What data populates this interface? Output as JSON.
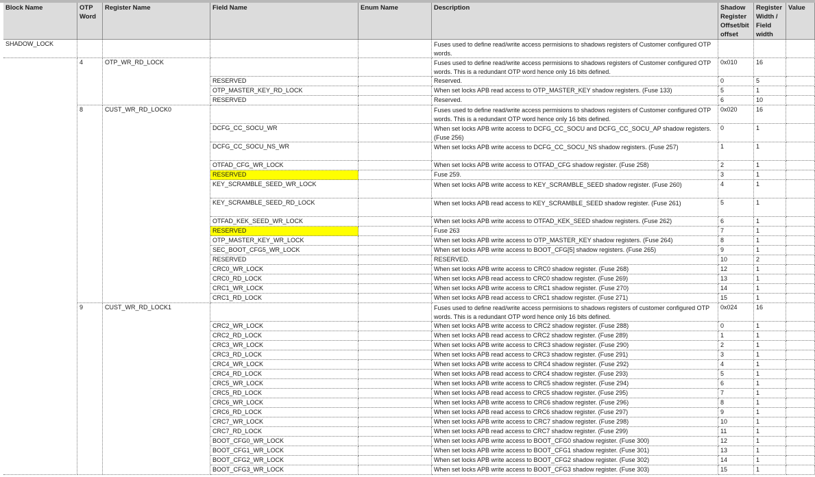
{
  "headers": [
    "Block Name",
    "OTP Word",
    "Register Name",
    "Field Name",
    "Enum Name",
    "Description",
    "Shadow Register Offset/bit offset",
    "Register Width / Field width",
    "Value"
  ],
  "block_name": "SHADOW_LOCK",
  "block_desc": "Fuses used to define read/write access permisions to shadows registers of Customer configured OTP words.",
  "rows": [
    {
      "otp": "4",
      "reg": "OTP_WR_RD_LOCK",
      "field": "",
      "desc": "Fuses used to define read/write access permisions to shadows registers of Customer configured OTP words. This is a redundant OTP word hence only 16 bits defined.",
      "off": "0x010",
      "width": "16"
    },
    {
      "field": "RESERVED",
      "desc": "Reserved.",
      "off": "0",
      "width": "5"
    },
    {
      "field": "OTP_MASTER_KEY_RD_LOCK",
      "desc": "When set locks APB read access to OTP_MASTER_KEY shadow registers. (Fuse 133)",
      "off": "5",
      "width": "1"
    },
    {
      "field": "RESERVED",
      "desc": "Reserved.",
      "off": "6",
      "width": "10"
    },
    {
      "otp": "8",
      "reg": "CUST_WR_RD_LOCK0",
      "field": "",
      "desc": "Fuses used to define read/write access permisions to shadows registers of Customer configured OTP words. This is a redundant OTP word hence only 16 bits defined.",
      "off": "0x020",
      "width": "16"
    },
    {
      "field": "DCFG_CC_SOCU_WR",
      "desc": "When set locks APB write access to DCFG_CC_SOCU and DCFG_CC_SOCU_AP shadow registers. (Fuse 256)",
      "off": "0",
      "width": "1"
    },
    {
      "field": "DCFG_CC_SOCU_NS_WR",
      "desc": "When set locks APB write access to DCFG_CC_SOCU_NS shadow registers. (Fuse 257)",
      "off": "1",
      "width": "1"
    },
    {
      "field": "OTFAD_CFG_WR_LOCK",
      "desc": "When set locks APB write access to OTFAD_CFG shadow register. (Fuse 258)",
      "off": "2",
      "width": "1"
    },
    {
      "field": "RESERVED",
      "desc": "Fuse 259.",
      "off": "3",
      "width": "1",
      "hl": true
    },
    {
      "field": "KEY_SCRAMBLE_SEED_WR_LOCK",
      "desc": "When set locks APB write access to KEY_SCRAMBLE_SEED shadow register. (Fuse 260)",
      "off": "4",
      "width": "1"
    },
    {
      "field": "KEY_SCRAMBLE_SEED_RD_LOCK",
      "desc": "When set locks APB read access to KEY_SCRAMBLE_SEED shadow register. (Fuse 261)",
      "off": "5",
      "width": "1"
    },
    {
      "field": "OTFAD_KEK_SEED_WR_LOCK",
      "desc": "When set locks APB write access to OTFAD_KEK_SEED shadow registers. (Fuse 262)",
      "off": "6",
      "width": "1"
    },
    {
      "field": "RESERVED",
      "desc": "Fuse 263",
      "off": "7",
      "width": "1",
      "hl": true
    },
    {
      "field": "OTP_MASTER_KEY_WR_LOCK",
      "desc": "When set locks APB write access to OTP_MASTER_KEY shadow registers. (Fuse 264)",
      "off": "8",
      "width": "1"
    },
    {
      "field": "SEC_BOOT_CFG5_WR_LOCK",
      "desc": "When set locks APB write access to BOOT_CFG[5] shadow registers. (Fuse 265)",
      "off": "9",
      "width": "1"
    },
    {
      "field": "RESERVED",
      "desc": "RESERVED.",
      "off": "10",
      "width": "2"
    },
    {
      "field": "CRC0_WR_LOCK",
      "desc": "When set locks APB write access to CRC0 shadow register. (Fuse 268)",
      "off": "12",
      "width": "1"
    },
    {
      "field": "CRC0_RD_LOCK",
      "desc": "When set locks APB read access to CRC0 shadow register. (Fuse 269)",
      "off": "13",
      "width": "1"
    },
    {
      "field": "CRC1_WR_LOCK",
      "desc": "When set locks APB write access to CRC1 shadow register. (Fuse 270)",
      "off": "14",
      "width": "1"
    },
    {
      "field": "CRC1_RD_LOCK",
      "desc": "When set locks APB read access to CRC1 shadow register. (Fuse 271)",
      "off": "15",
      "width": "1"
    },
    {
      "otp": "9",
      "reg": "CUST_WR_RD_LOCK1",
      "field": "",
      "desc": "Fuses used to define read/write access permisions to shadows registers of customer configured OTP words. This is a redundant OTP word hence only 16 bits defined.",
      "off": "0x024",
      "width": "16"
    },
    {
      "field": "CRC2_WR_LOCK",
      "desc": "When set locks APB write access to CRC2 shadow register. (Fuse 288)",
      "off": "0",
      "width": "1"
    },
    {
      "field": "CRC2_RD_LOCK",
      "desc": "When set locks APB read access to CRC2 shadow register. (Fuse 289)",
      "off": "1",
      "width": "1"
    },
    {
      "field": "CRC3_WR_LOCK",
      "desc": "When set locks APB write access to CRC3 shadow register. (Fuse 290)",
      "off": "2",
      "width": "1"
    },
    {
      "field": "CRC3_RD_LOCK",
      "desc": "When set locks APB read access to CRC3 shadow register. (Fuse 291)",
      "off": "3",
      "width": "1"
    },
    {
      "field": "CRC4_WR_LOCK",
      "desc": "When set locks APB write access to CRC4 shadow register. (Fuse 292)",
      "off": "4",
      "width": "1"
    },
    {
      "field": "CRC4_RD_LOCK",
      "desc": "When set locks APB read access to CRC4 shadow register. (Fuse 293)",
      "off": "5",
      "width": "1"
    },
    {
      "field": "CRC5_WR_LOCK",
      "desc": "When set locks APB write access to CRC5 shadow register. (Fuse 294)",
      "off": "6",
      "width": "1"
    },
    {
      "field": "CRC5_RD_LOCK",
      "desc": "When set locks APB read access to CRC5 shadow register. (Fuse 295)",
      "off": "7",
      "width": "1"
    },
    {
      "field": "CRC6_WR_LOCK",
      "desc": "When set locks APB write access to CRC6 shadow register. (Fuse 296)",
      "off": "8",
      "width": "1"
    },
    {
      "field": "CRC6_RD_LOCK",
      "desc": "When set locks APB read access to CRC6 shadow register. (Fuse 297)",
      "off": "9",
      "width": "1"
    },
    {
      "field": "CRC7_WR_LOCK",
      "desc": "When set locks APB write access to CRC7 shadow register. (Fuse 298)",
      "off": "10",
      "width": "1"
    },
    {
      "field": "CRC7_RD_LOCK",
      "desc": "When set locks APB read access to CRC7 shadow register. (Fuse 299)",
      "off": "11",
      "width": "1"
    },
    {
      "field": "BOOT_CFG0_WR_LOCK",
      "desc": "When set locks APB write access to BOOT_CFG0 shadow register. (Fuse 300)",
      "off": "12",
      "width": "1"
    },
    {
      "field": "BOOT_CFG1_WR_LOCK",
      "desc": "When set locks APB write access to BOOT_CFG1 shadow register. (Fuse 301)",
      "off": "13",
      "width": "1"
    },
    {
      "field": "BOOT_CFG2_WR_LOCK",
      "desc": "When set locks APB write access to BOOT_CFG2 shadow register. (Fuse 302)",
      "off": "14",
      "width": "1"
    },
    {
      "field": "BOOT_CFG3_WR_LOCK",
      "desc": "When set locks APB write access to BOOT_CFG3 shadow register. (Fuse 303)",
      "off": "15",
      "width": "1"
    }
  ]
}
